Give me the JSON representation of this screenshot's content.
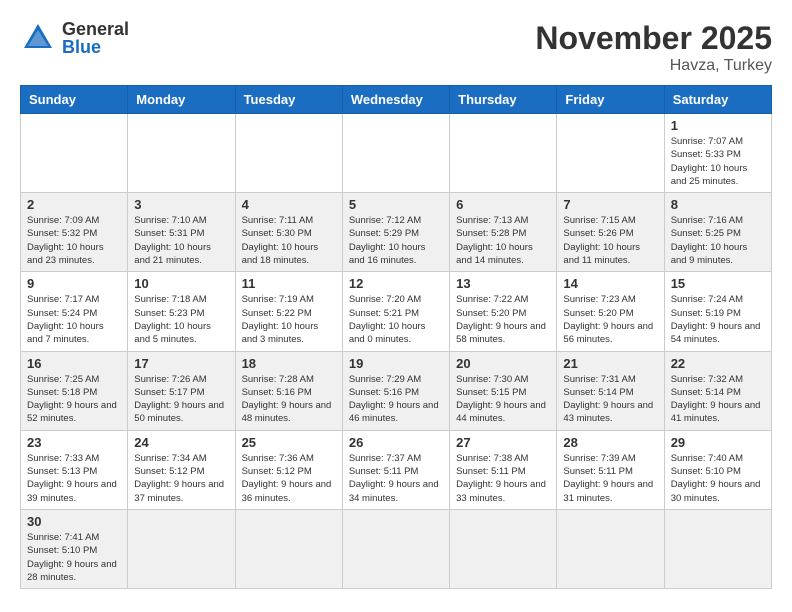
{
  "header": {
    "logo_general": "General",
    "logo_blue": "Blue",
    "month_title": "November 2025",
    "subtitle": "Havza, Turkey"
  },
  "days_of_week": [
    "Sunday",
    "Monday",
    "Tuesday",
    "Wednesday",
    "Thursday",
    "Friday",
    "Saturday"
  ],
  "weeks": [
    [
      {
        "day": "",
        "info": ""
      },
      {
        "day": "",
        "info": ""
      },
      {
        "day": "",
        "info": ""
      },
      {
        "day": "",
        "info": ""
      },
      {
        "day": "",
        "info": ""
      },
      {
        "day": "",
        "info": ""
      },
      {
        "day": "1",
        "info": "Sunrise: 7:07 AM\nSunset: 5:33 PM\nDaylight: 10 hours and 25 minutes."
      }
    ],
    [
      {
        "day": "2",
        "info": "Sunrise: 7:09 AM\nSunset: 5:32 PM\nDaylight: 10 hours and 23 minutes."
      },
      {
        "day": "3",
        "info": "Sunrise: 7:10 AM\nSunset: 5:31 PM\nDaylight: 10 hours and 21 minutes."
      },
      {
        "day": "4",
        "info": "Sunrise: 7:11 AM\nSunset: 5:30 PM\nDaylight: 10 hours and 18 minutes."
      },
      {
        "day": "5",
        "info": "Sunrise: 7:12 AM\nSunset: 5:29 PM\nDaylight: 10 hours and 16 minutes."
      },
      {
        "day": "6",
        "info": "Sunrise: 7:13 AM\nSunset: 5:28 PM\nDaylight: 10 hours and 14 minutes."
      },
      {
        "day": "7",
        "info": "Sunrise: 7:15 AM\nSunset: 5:26 PM\nDaylight: 10 hours and 11 minutes."
      },
      {
        "day": "8",
        "info": "Sunrise: 7:16 AM\nSunset: 5:25 PM\nDaylight: 10 hours and 9 minutes."
      }
    ],
    [
      {
        "day": "9",
        "info": "Sunrise: 7:17 AM\nSunset: 5:24 PM\nDaylight: 10 hours and 7 minutes."
      },
      {
        "day": "10",
        "info": "Sunrise: 7:18 AM\nSunset: 5:23 PM\nDaylight: 10 hours and 5 minutes."
      },
      {
        "day": "11",
        "info": "Sunrise: 7:19 AM\nSunset: 5:22 PM\nDaylight: 10 hours and 3 minutes."
      },
      {
        "day": "12",
        "info": "Sunrise: 7:20 AM\nSunset: 5:21 PM\nDaylight: 10 hours and 0 minutes."
      },
      {
        "day": "13",
        "info": "Sunrise: 7:22 AM\nSunset: 5:20 PM\nDaylight: 9 hours and 58 minutes."
      },
      {
        "day": "14",
        "info": "Sunrise: 7:23 AM\nSunset: 5:20 PM\nDaylight: 9 hours and 56 minutes."
      },
      {
        "day": "15",
        "info": "Sunrise: 7:24 AM\nSunset: 5:19 PM\nDaylight: 9 hours and 54 minutes."
      }
    ],
    [
      {
        "day": "16",
        "info": "Sunrise: 7:25 AM\nSunset: 5:18 PM\nDaylight: 9 hours and 52 minutes."
      },
      {
        "day": "17",
        "info": "Sunrise: 7:26 AM\nSunset: 5:17 PM\nDaylight: 9 hours and 50 minutes."
      },
      {
        "day": "18",
        "info": "Sunrise: 7:28 AM\nSunset: 5:16 PM\nDaylight: 9 hours and 48 minutes."
      },
      {
        "day": "19",
        "info": "Sunrise: 7:29 AM\nSunset: 5:16 PM\nDaylight: 9 hours and 46 minutes."
      },
      {
        "day": "20",
        "info": "Sunrise: 7:30 AM\nSunset: 5:15 PM\nDaylight: 9 hours and 44 minutes."
      },
      {
        "day": "21",
        "info": "Sunrise: 7:31 AM\nSunset: 5:14 PM\nDaylight: 9 hours and 43 minutes."
      },
      {
        "day": "22",
        "info": "Sunrise: 7:32 AM\nSunset: 5:14 PM\nDaylight: 9 hours and 41 minutes."
      }
    ],
    [
      {
        "day": "23",
        "info": "Sunrise: 7:33 AM\nSunset: 5:13 PM\nDaylight: 9 hours and 39 minutes."
      },
      {
        "day": "24",
        "info": "Sunrise: 7:34 AM\nSunset: 5:12 PM\nDaylight: 9 hours and 37 minutes."
      },
      {
        "day": "25",
        "info": "Sunrise: 7:36 AM\nSunset: 5:12 PM\nDaylight: 9 hours and 36 minutes."
      },
      {
        "day": "26",
        "info": "Sunrise: 7:37 AM\nSunset: 5:11 PM\nDaylight: 9 hours and 34 minutes."
      },
      {
        "day": "27",
        "info": "Sunrise: 7:38 AM\nSunset: 5:11 PM\nDaylight: 9 hours and 33 minutes."
      },
      {
        "day": "28",
        "info": "Sunrise: 7:39 AM\nSunset: 5:11 PM\nDaylight: 9 hours and 31 minutes."
      },
      {
        "day": "29",
        "info": "Sunrise: 7:40 AM\nSunset: 5:10 PM\nDaylight: 9 hours and 30 minutes."
      }
    ],
    [
      {
        "day": "30",
        "info": "Sunrise: 7:41 AM\nSunset: 5:10 PM\nDaylight: 9 hours and 28 minutes."
      },
      {
        "day": "",
        "info": ""
      },
      {
        "day": "",
        "info": ""
      },
      {
        "day": "",
        "info": ""
      },
      {
        "day": "",
        "info": ""
      },
      {
        "day": "",
        "info": ""
      },
      {
        "day": "",
        "info": ""
      }
    ]
  ]
}
